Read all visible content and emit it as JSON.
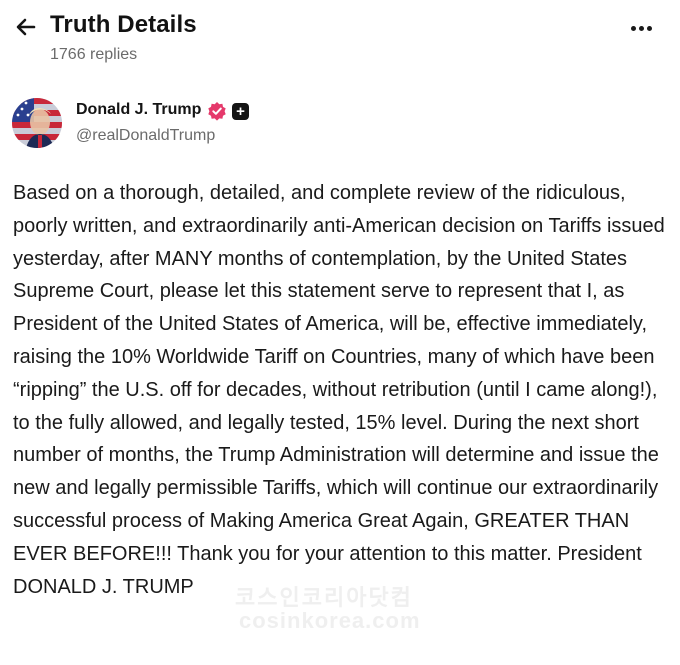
{
  "header": {
    "title": "Truth Details",
    "replies_count": "1766 replies",
    "back_icon": "arrow-left-icon",
    "more_icon": "more-horizontal-icon"
  },
  "author": {
    "name": "Donald J. Trump",
    "handle": "@realDonaldTrump",
    "verified_icon": "verified-badge-icon",
    "plus_badge": "+",
    "verified_color": "#e5396b"
  },
  "post": {
    "text": "Based on a thorough, detailed, and complete review of the ridiculous, poorly written, and extraordinarily anti-American decision on Tariffs issued yesterday, after MANY months of contemplation, by the United States Supreme Court, please let this statement serve to represent that I, as President of the United States of America, will be, effective immediately, raising the 10% Worldwide Tariff on Countries, many of which have been “ripping” the U.S. off for decades, without retribution (until I came along!), to the fully allowed, and legally tested, 15% level. During the next short number of months, the Trump Administration will determine and issue the new and legally permissible Tariffs, which will continue our extraordinarily successful process of Making America Great Again, GREATER THAN EVER BEFORE!!! Thank you for your attention to this matter. President DONALD J. TRUMP"
  },
  "watermark": {
    "korean": "코스인코리아닷컴",
    "domain": "cosinkorea.com"
  }
}
